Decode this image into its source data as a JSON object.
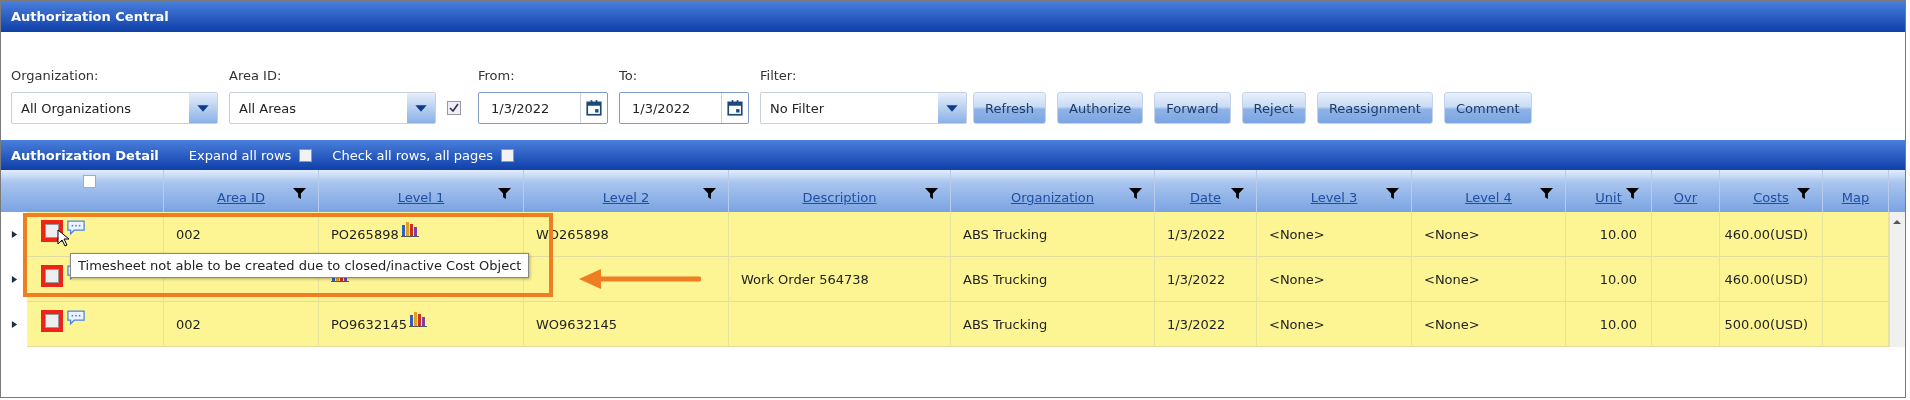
{
  "window": {
    "title": "Authorization Central"
  },
  "filters": {
    "organization": {
      "label": "Organization:",
      "value": "All Organizations"
    },
    "area_id": {
      "label": "Area ID:",
      "value": "All Areas"
    },
    "date_enabled": {
      "checked": true
    },
    "from": {
      "label": "From:",
      "value": "1/3/2022"
    },
    "to": {
      "label": "To:",
      "value": "1/3/2022"
    },
    "filter": {
      "label": "Filter:",
      "value": "No Filter"
    }
  },
  "buttons": [
    "Refresh",
    "Authorize",
    "Forward",
    "Reject",
    "Reassignment",
    "Comment"
  ],
  "detail_bar": {
    "title": "Authorization Detail",
    "options": [
      {
        "label": "Expand all rows",
        "checked": false
      },
      {
        "label": "Check all rows, all pages",
        "checked": false
      }
    ]
  },
  "table": {
    "header_checked": false,
    "columns": [
      {
        "label": "Area ID",
        "filter": true
      },
      {
        "label": "Level 1",
        "filter": true
      },
      {
        "label": "Level 2",
        "filter": true
      },
      {
        "label": "Description",
        "filter": true
      },
      {
        "label": "Organization",
        "filter": true
      },
      {
        "label": "Date",
        "filter": true
      },
      {
        "label": "Level 3",
        "filter": true
      },
      {
        "label": "Level 4",
        "filter": true
      },
      {
        "label": "Unit",
        "filter": true
      },
      {
        "label": "Ovr",
        "filter": false
      },
      {
        "label": "Costs",
        "filter": true
      },
      {
        "label": "Map",
        "filter": false
      }
    ],
    "rows": [
      {
        "flagged": true,
        "checked": false,
        "cells": [
          "002",
          "PO265898",
          "WO265898",
          null,
          "ABS Trucking",
          "1/3/2022",
          "<None>",
          "<None>",
          "10.00",
          null,
          "460.00(USD)",
          null
        ]
      },
      {
        "flagged": true,
        "checked": false,
        "cells": [
          null,
          null,
          null,
          "Work Order 564738",
          "ABS Trucking",
          "1/3/2022",
          "<None>",
          "<None>",
          "10.00",
          null,
          "460.00(USD)",
          null
        ]
      },
      {
        "flagged": true,
        "checked": false,
        "cells": [
          "002",
          "PO9632145",
          "WO9632145",
          null,
          "ABS Trucking",
          "1/3/2022",
          "<None>",
          "<None>",
          "10.00",
          null,
          "500.00(USD)",
          null
        ]
      }
    ]
  },
  "tooltip": {
    "text": "Timesheet not able to be created due to closed/inactive Cost Object"
  }
}
